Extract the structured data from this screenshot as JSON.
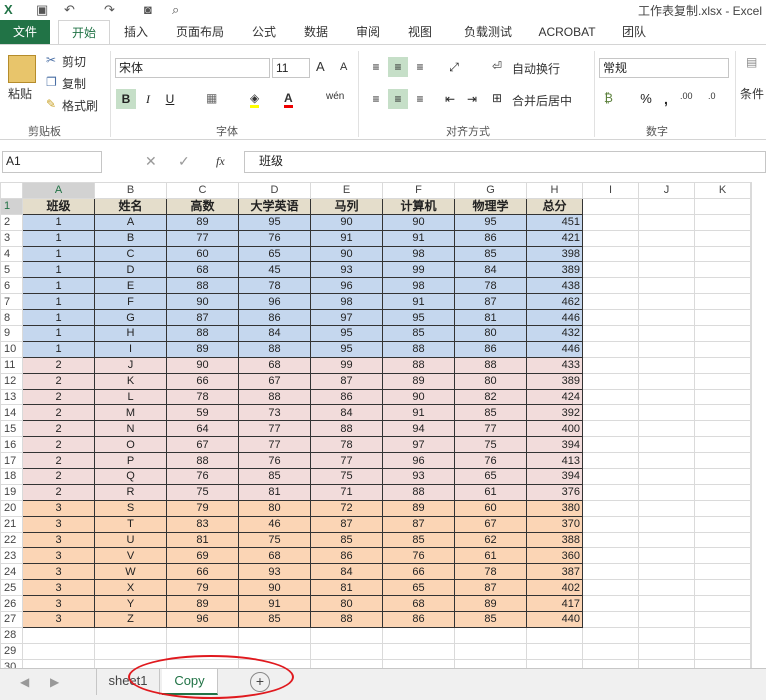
{
  "titlebar": {
    "title": "工作表复制.xlsx - Excel"
  },
  "tabs": [
    "文件",
    "开始",
    "插入",
    "页面布局",
    "公式",
    "数据",
    "审阅",
    "视图",
    "负载测试",
    "ACROBAT",
    "团队"
  ],
  "ribbon": {
    "clipboard": {
      "paste": "粘贴",
      "cut": "剪切",
      "copy": "复制",
      "format_painter": "格式刷",
      "label": "剪贴板"
    },
    "font": {
      "name": "宋体",
      "size": "11",
      "bold": "B",
      "italic": "I",
      "underline": "U",
      "label": "字体"
    },
    "align": {
      "wrap": "自动换行",
      "merge": "合并后居中",
      "label": "对齐方式"
    },
    "number": {
      "format": "常规",
      "percent": "%",
      "comma": ",",
      "label": "数字"
    },
    "styles": {
      "cond": "条件"
    }
  },
  "formula": {
    "cell_ref": "A1",
    "fx": "fx",
    "content": "班级"
  },
  "grid": {
    "col_letters": [
      "A",
      "B",
      "C",
      "D",
      "E",
      "F",
      "G",
      "H",
      "I",
      "J",
      "K"
    ],
    "headers": [
      "班级",
      "姓名",
      "高数",
      "大学英语",
      "马列",
      "计算机",
      "物理学",
      "总分"
    ],
    "rows": [
      [
        "1",
        "A",
        "89",
        "95",
        "90",
        "90",
        "95",
        "451"
      ],
      [
        "1",
        "B",
        "77",
        "76",
        "91",
        "91",
        "86",
        "421"
      ],
      [
        "1",
        "C",
        "60",
        "65",
        "90",
        "98",
        "85",
        "398"
      ],
      [
        "1",
        "D",
        "68",
        "45",
        "93",
        "99",
        "84",
        "389"
      ],
      [
        "1",
        "E",
        "88",
        "78",
        "96",
        "98",
        "78",
        "438"
      ],
      [
        "1",
        "F",
        "90",
        "96",
        "98",
        "91",
        "87",
        "462"
      ],
      [
        "1",
        "G",
        "87",
        "86",
        "97",
        "95",
        "81",
        "446"
      ],
      [
        "1",
        "H",
        "88",
        "84",
        "95",
        "85",
        "80",
        "432"
      ],
      [
        "1",
        "I",
        "89",
        "88",
        "95",
        "88",
        "86",
        "446"
      ],
      [
        "2",
        "J",
        "90",
        "68",
        "99",
        "88",
        "88",
        "433"
      ],
      [
        "2",
        "K",
        "66",
        "67",
        "87",
        "89",
        "80",
        "389"
      ],
      [
        "2",
        "L",
        "78",
        "88",
        "86",
        "90",
        "82",
        "424"
      ],
      [
        "2",
        "M",
        "59",
        "73",
        "84",
        "91",
        "85",
        "392"
      ],
      [
        "2",
        "N",
        "64",
        "77",
        "88",
        "94",
        "77",
        "400"
      ],
      [
        "2",
        "O",
        "67",
        "77",
        "78",
        "97",
        "75",
        "394"
      ],
      [
        "2",
        "P",
        "88",
        "76",
        "77",
        "96",
        "76",
        "413"
      ],
      [
        "2",
        "Q",
        "76",
        "85",
        "75",
        "93",
        "65",
        "394"
      ],
      [
        "2",
        "R",
        "75",
        "81",
        "71",
        "88",
        "61",
        "376"
      ],
      [
        "3",
        "S",
        "79",
        "80",
        "72",
        "89",
        "60",
        "380"
      ],
      [
        "3",
        "T",
        "83",
        "46",
        "87",
        "87",
        "67",
        "370"
      ],
      [
        "3",
        "U",
        "81",
        "75",
        "85",
        "85",
        "62",
        "388"
      ],
      [
        "3",
        "V",
        "69",
        "68",
        "86",
        "76",
        "61",
        "360"
      ],
      [
        "3",
        "W",
        "66",
        "93",
        "84",
        "66",
        "78",
        "387"
      ],
      [
        "3",
        "X",
        "79",
        "90",
        "81",
        "65",
        "87",
        "402"
      ],
      [
        "3",
        "Y",
        "89",
        "91",
        "80",
        "68",
        "89",
        "417"
      ],
      [
        "3",
        "Z",
        "96",
        "85",
        "88",
        "86",
        "85",
        "440"
      ]
    ]
  },
  "sheet_tabs": [
    "sheet1",
    "Copy"
  ],
  "add_sheet": "+"
}
